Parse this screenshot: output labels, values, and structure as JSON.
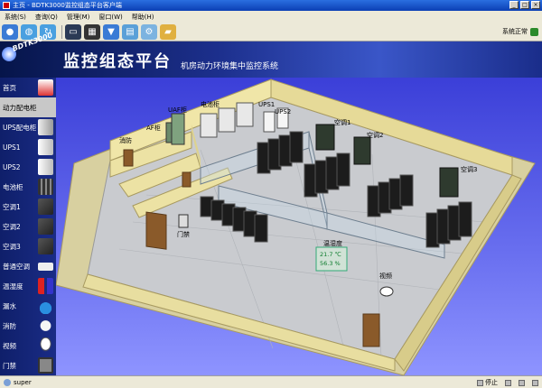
{
  "window": {
    "title": "主页 - BDTK3000监控组态平台客户端"
  },
  "menu": [
    "系统(S)",
    "查询(Q)",
    "管理(M)",
    "窗口(W)",
    "帮助(H)"
  ],
  "toolbar": {
    "status_text": "系统正常"
  },
  "header": {
    "logo_text": "BDTK3000",
    "title": "监控组态平台",
    "subtitle": "机房动力环境集中监控系统"
  },
  "sidebar": [
    {
      "label": "首页",
      "icon": "home-icon"
    },
    {
      "label": "动力配电柜",
      "icon": "power-cabinet-icon"
    },
    {
      "label": "UPS配电柜",
      "icon": "ups-cabinet-icon"
    },
    {
      "label": "UPS1",
      "icon": "ups-icon"
    },
    {
      "label": "UPS2",
      "icon": "ups-icon"
    },
    {
      "label": "电池柜",
      "icon": "battery-icon"
    },
    {
      "label": "空调1",
      "icon": "aircon-icon"
    },
    {
      "label": "空调2",
      "icon": "aircon-icon"
    },
    {
      "label": "空调3",
      "icon": "aircon-icon"
    },
    {
      "label": "普通空调",
      "icon": "split-aircon-icon"
    },
    {
      "label": "温湿度",
      "icon": "thermometer-icon"
    },
    {
      "label": "漏水",
      "icon": "water-drop-icon"
    },
    {
      "label": "消防",
      "icon": "fire-icon"
    },
    {
      "label": "视频",
      "icon": "camera-icon"
    },
    {
      "label": "门禁",
      "icon": "door-access-icon"
    }
  ],
  "floorplan": {
    "labels": {
      "fire": "消防",
      "af": "AF柜",
      "uaf": "UAF柜",
      "battery": "电池柜",
      "ups1": "UPS1",
      "ups2": "UPS2",
      "ac1": "空调1",
      "ac2": "空调2",
      "ac3": "空调3",
      "door": "门禁",
      "video": "视频",
      "temp_title": "温湿度"
    },
    "temperature": "21.7 ℃",
    "humidity": "56.3 %"
  },
  "statusbar": {
    "user": "super",
    "stop": "停止",
    "extra": "□"
  },
  "colors": {
    "accent": "#1a2c86",
    "wall": "#f0e6a8",
    "floor": "#c8c8c8"
  }
}
